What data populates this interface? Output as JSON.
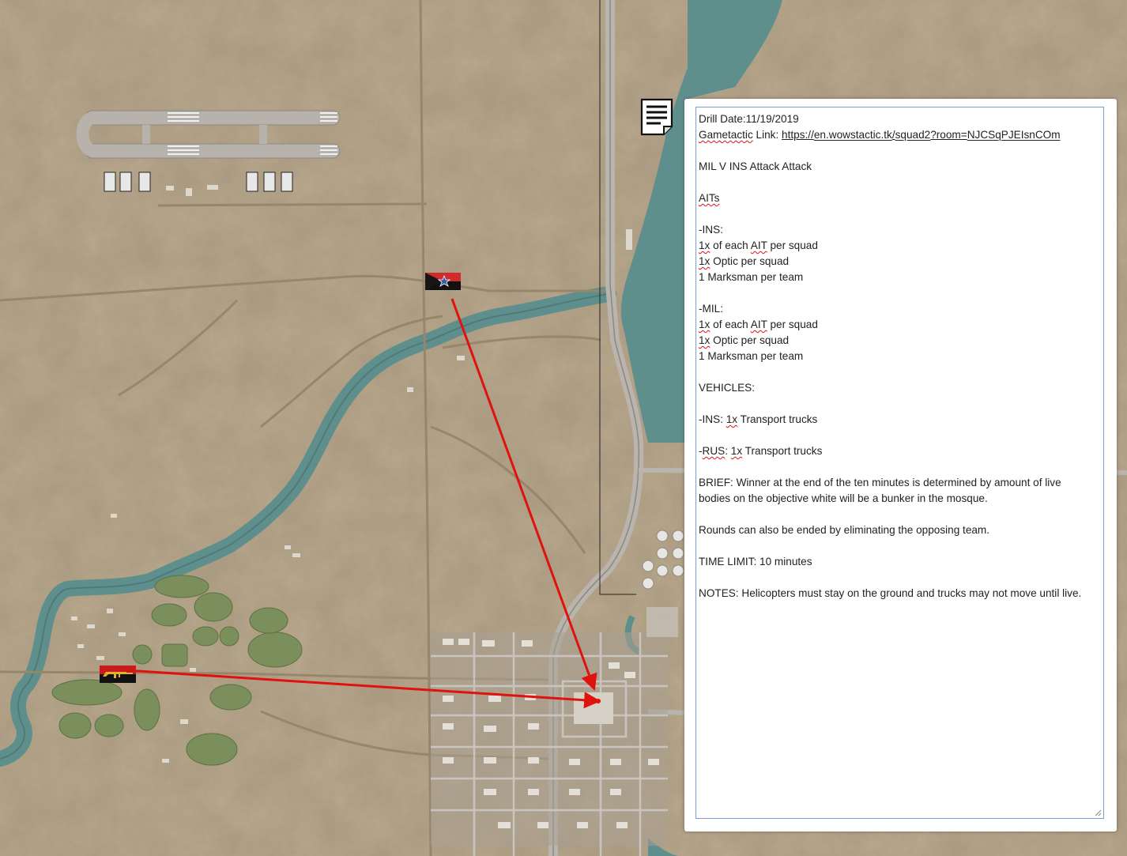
{
  "map": {
    "background_color": "#b5a48a",
    "water_color": "#5f8f8d",
    "road_color": "#9a8a72",
    "arrow_color": "#e0120e"
  },
  "markers": [
    {
      "name": "ins-flag",
      "icon": "red-black-star-flag"
    },
    {
      "name": "mil-flag",
      "icon": "black-red-rifle-flag"
    }
  ],
  "notes_icon": "notes-document-icon",
  "notes": {
    "lines": [
      [
        {
          "t": "Drill Date:11/19/2019"
        }
      ],
      [
        {
          "t": "Gametactic",
          "s": 1
        },
        {
          "t": " Link: "
        },
        {
          "t": "https",
          "l": 1
        },
        {
          "t": "://",
          "l": 1
        },
        {
          "t": "en.wowstactic.tk",
          "l": 1,
          "s": 1
        },
        {
          "t": "/",
          "l": 1
        },
        {
          "t": "squad2",
          "l": 1,
          "s": 1
        },
        {
          "t": "?room=",
          "l": 1
        },
        {
          "t": "NJCSqPJEIsnCOm",
          "l": 1,
          "s": 1
        }
      ],
      [],
      [
        {
          "t": "MIL V INS Attack Attack"
        }
      ],
      [],
      [
        {
          "t": "AITs",
          "s": 1
        }
      ],
      [],
      [
        {
          "t": "-INS:"
        }
      ],
      [
        {
          "t": "1x",
          "s": 1
        },
        {
          "t": " of each "
        },
        {
          "t": "AIT",
          "s": 1
        },
        {
          "t": " per squad"
        }
      ],
      [
        {
          "t": "1x",
          "s": 1
        },
        {
          "t": " Optic per squad"
        }
      ],
      [
        {
          "t": "1 Marksman per team"
        }
      ],
      [],
      [
        {
          "t": "-MIL:"
        }
      ],
      [
        {
          "t": "1x",
          "s": 1
        },
        {
          "t": " of each "
        },
        {
          "t": "AIT",
          "s": 1
        },
        {
          "t": " per squad"
        }
      ],
      [
        {
          "t": "1x",
          "s": 1
        },
        {
          "t": " Optic per squad"
        }
      ],
      [
        {
          "t": "1 Marksman per team"
        }
      ],
      [],
      [
        {
          "t": "VEHICLES:"
        }
      ],
      [],
      [
        {
          "t": "-INS: "
        },
        {
          "t": "1x",
          "s": 1
        },
        {
          "t": " Transport trucks"
        }
      ],
      [],
      [
        {
          "t": "-"
        },
        {
          "t": "RUS",
          "s": 1
        },
        {
          "t": ": "
        },
        {
          "t": "1x",
          "s": 1
        },
        {
          "t": " Transport trucks"
        }
      ],
      [],
      [
        {
          "t": "BRIEF: Winner at the end of the ten minutes is determined by amount of live"
        }
      ],
      [
        {
          "t": "bodies on the objective white will be a bunker in the mosque."
        }
      ],
      [],
      [
        {
          "t": "Rounds can also be ended by eliminating the opposing team."
        }
      ],
      [],
      [
        {
          "t": "TIME LIMIT: 10 minutes"
        }
      ],
      [],
      [
        {
          "t": "NOTES: Helicopters must stay on the ground and trucks may not move until live."
        }
      ]
    ]
  }
}
